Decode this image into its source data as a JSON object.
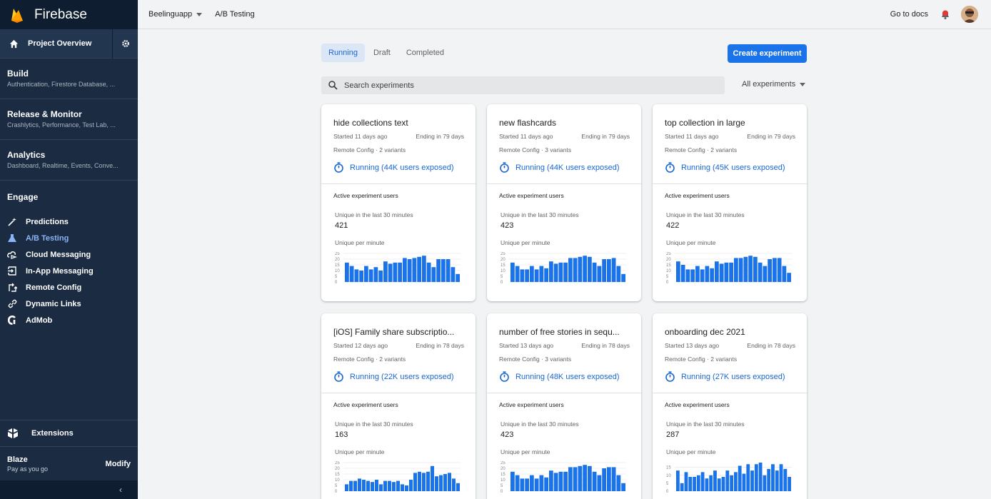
{
  "app": {
    "brand": "Firebase",
    "project": "Beelinguapp",
    "page": "A/B Testing",
    "docs": "Go to docs"
  },
  "sidebar": {
    "overview": "Project Overview",
    "sections": [
      {
        "title": "Build",
        "subtitle": "Authentication, Firestore Database, ..."
      },
      {
        "title": "Release & Monitor",
        "subtitle": "Crashlytics, Performance, Test Lab, ..."
      },
      {
        "title": "Analytics",
        "subtitle": "Dashboard, Realtime, Events, Conve..."
      }
    ],
    "engage": {
      "title": "Engage",
      "items": [
        {
          "label": "Predictions",
          "icon": "magic-wand-icon"
        },
        {
          "label": "A/B Testing",
          "icon": "flask-icon",
          "active": true
        },
        {
          "label": "Cloud Messaging",
          "icon": "cloud-messaging-icon"
        },
        {
          "label": "In-App Messaging",
          "icon": "in-app-messaging-icon"
        },
        {
          "label": "Remote Config",
          "icon": "remote-config-icon"
        },
        {
          "label": "Dynamic Links",
          "icon": "link-icon"
        },
        {
          "label": "AdMob",
          "icon": "admob-icon"
        }
      ]
    },
    "extensions": "Extensions",
    "plan": {
      "name": "Blaze",
      "desc": "Pay as you go",
      "modify": "Modify"
    },
    "collapse": "‹"
  },
  "main": {
    "tabs": [
      "Running",
      "Draft",
      "Completed"
    ],
    "active_tab": "Running",
    "create_label": "Create experiment",
    "search_placeholder": "Search experiments",
    "filter": "All experiments",
    "labels": {
      "active_users": "Active experiment users",
      "unique30": "Unique in the last 30 minutes",
      "unique_per_min": "Unique per minute"
    },
    "colors": {
      "accent": "#1a73e8",
      "bar": "#1a73e8",
      "sidebar": "#1a2b42"
    }
  },
  "experiments": [
    {
      "title": "hide collections text",
      "started": "Started 11 days ago",
      "ending": "Ending in 79 days",
      "config": "Remote Config · 2 variants",
      "status": "Running (44K users exposed)",
      "unique30": "421",
      "ticks": [
        "25",
        "20",
        "15",
        "10",
        "5",
        "0"
      ],
      "ymax": 25,
      "bars": [
        17,
        14,
        11,
        10,
        14,
        11,
        13,
        10,
        18,
        16,
        17,
        17,
        21,
        20,
        21,
        22,
        23,
        17,
        13,
        20,
        20,
        20,
        13,
        7
      ]
    },
    {
      "title": "new flashcards",
      "started": "Started 11 days ago",
      "ending": "Ending in 79 days",
      "config": "Remote Config · 3 variants",
      "status": "Running (44K users exposed)",
      "unique30": "423",
      "ticks": [
        "25",
        "20",
        "15",
        "10",
        "5",
        "0"
      ],
      "ymax": 25,
      "bars": [
        17,
        14,
        11,
        11,
        14,
        11,
        14,
        12,
        18,
        16,
        17,
        17,
        21,
        21,
        22,
        23,
        22,
        17,
        14,
        20,
        20,
        21,
        14,
        7
      ]
    },
    {
      "title": "top collection in large",
      "started": "Started 11 days ago",
      "ending": "Ending in 79 days",
      "config": "Remote Config · 2 variants",
      "status": "Running (45K users exposed)",
      "unique30": "422",
      "ticks": [
        "25",
        "20",
        "15",
        "10",
        "5",
        "0"
      ],
      "ymax": 25,
      "bars": [
        18,
        15,
        11,
        11,
        14,
        11,
        14,
        12,
        18,
        16,
        17,
        17,
        21,
        21,
        22,
        23,
        22,
        17,
        14,
        20,
        21,
        21,
        14,
        8
      ]
    },
    {
      "title": "[iOS] Family share subscriptio...",
      "started": "Started 12 days ago",
      "ending": "Ending in 78 days",
      "config": "Remote Config · 2 variants",
      "status": "Running (22K users exposed)",
      "unique30": "163",
      "ticks": [
        "25",
        "20",
        "15",
        "10",
        "5",
        "0"
      ],
      "ymax": 25,
      "bars": [
        6,
        9,
        9,
        11,
        10,
        9,
        8,
        10,
        6,
        9,
        9,
        8,
        9,
        6,
        5,
        10,
        16,
        17,
        16,
        17,
        22,
        13,
        14,
        15,
        16,
        11,
        7
      ]
    },
    {
      "title": "number of free stories in sequ...",
      "started": "Started 13 days ago",
      "ending": "Ending in 78 days",
      "config": "Remote Config · 3 variants",
      "status": "Running (48K users exposed)",
      "unique30": "423",
      "ticks": [
        "25",
        "20",
        "15",
        "10",
        "5",
        "0"
      ],
      "ymax": 25,
      "bars": [
        17,
        14,
        11,
        11,
        14,
        11,
        14,
        12,
        18,
        16,
        17,
        17,
        21,
        21,
        22,
        23,
        22,
        17,
        14,
        20,
        21,
        21,
        14,
        7
      ]
    },
    {
      "title": "onboarding dec 2021",
      "started": "Started 13 days ago",
      "ending": "Ending in 78 days",
      "config": "Remote Config · 2 variants",
      "status": "Running (27K users exposed)",
      "unique30": "287",
      "ticks": [
        "15",
        "10",
        "5",
        "0"
      ],
      "ymax": 18,
      "bars": [
        13,
        5,
        12,
        9,
        9,
        10,
        12,
        8,
        10,
        13,
        8,
        9,
        13,
        10,
        12,
        16,
        11,
        17,
        13,
        17,
        18,
        10,
        14,
        17,
        13,
        17,
        14,
        9
      ]
    }
  ]
}
